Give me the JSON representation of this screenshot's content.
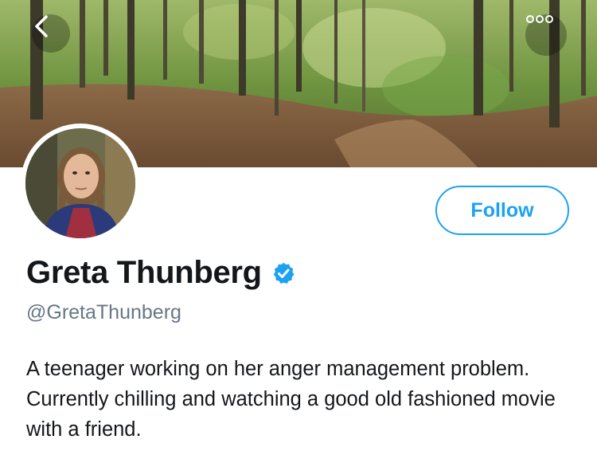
{
  "header": {
    "back_icon": "chevron-left-icon",
    "more_icon": "more-dots-icon"
  },
  "profile": {
    "display_name": "Greta Thunberg",
    "handle": "@GretaThunberg",
    "verified_icon": "verified-badge-icon",
    "bio": "A teenager working on her anger management problem. Currently chilling and watching a good old fashioned movie with a friend.",
    "follow_label": "Follow"
  },
  "colors": {
    "accent": "#1da1f2",
    "text": "#14171a",
    "secondary_text": "#657786"
  }
}
